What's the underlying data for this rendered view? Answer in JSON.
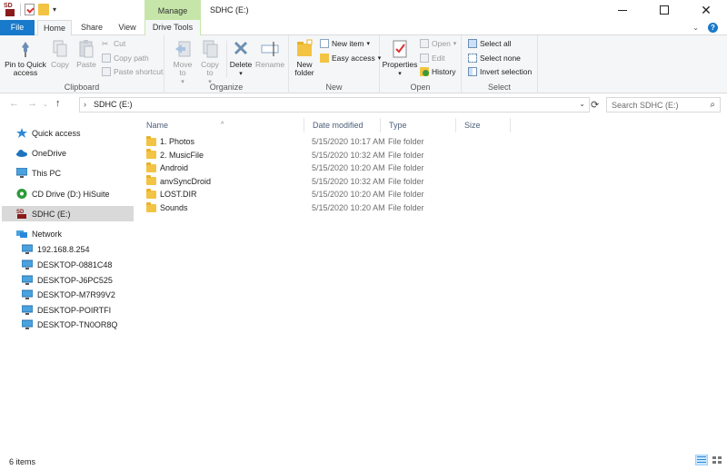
{
  "window": {
    "title": "SDHC (E:)",
    "context_tab": "Manage"
  },
  "tabs": [
    "File",
    "Home",
    "Share",
    "View",
    "Drive Tools"
  ],
  "ribbon": {
    "clipboard": {
      "label": "Clipboard",
      "pin": "Pin to Quick access",
      "copy": "Copy",
      "paste": "Paste",
      "cut": "Cut",
      "copy_path": "Copy path",
      "paste_shortcut": "Paste shortcut"
    },
    "organize": {
      "label": "Organize",
      "move_to": "Move to",
      "copy_to": "Copy to",
      "delete": "Delete",
      "rename": "Rename"
    },
    "new": {
      "label": "New",
      "new_folder": "New folder",
      "new_item": "New item",
      "easy_access": "Easy access"
    },
    "open": {
      "label": "Open",
      "properties": "Properties",
      "open": "Open",
      "edit": "Edit",
      "history": "History"
    },
    "select": {
      "label": "Select",
      "select_all": "Select all",
      "select_none": "Select none",
      "invert": "Invert selection"
    }
  },
  "address": {
    "path": "SDHC (E:)",
    "search_placeholder": "Search SDHC (E:)"
  },
  "nav": {
    "quick_access": "Quick access",
    "onedrive": "OneDrive",
    "this_pc": "This PC",
    "cd_drive": "CD Drive (D:) HiSuite",
    "sdhc": "SDHC (E:)",
    "network": "Network",
    "computers": [
      "192.168.8.254",
      "DESKTOP-0881C48",
      "DESKTOP-J6PC525",
      "DESKTOP-M7R99V2",
      "DESKTOP-POIRTFI",
      "DESKTOP-TN0OR8Q"
    ]
  },
  "columns": {
    "name": "Name",
    "date": "Date modified",
    "type": "Type",
    "size": "Size"
  },
  "files": [
    {
      "name": "1. Photos",
      "date": "5/15/2020 10:17 AM",
      "type": "File folder"
    },
    {
      "name": "2. MusicFile",
      "date": "5/15/2020 10:32 AM",
      "type": "File folder"
    },
    {
      "name": "Android",
      "date": "5/15/2020 10:20 AM",
      "type": "File folder"
    },
    {
      "name": "anvSyncDroid",
      "date": "5/15/2020 10:32 AM",
      "type": "File folder"
    },
    {
      "name": "LOST.DIR",
      "date": "5/15/2020 10:20 AM",
      "type": "File folder"
    },
    {
      "name": "Sounds",
      "date": "5/15/2020 10:20 AM",
      "type": "File folder"
    }
  ],
  "status": {
    "count": "6 items"
  },
  "colors": {
    "file_tab": "#1979ca",
    "context_tab": "#c6e6a9",
    "folder": "#f3c343",
    "selected_nav": "#d9d9d9"
  }
}
